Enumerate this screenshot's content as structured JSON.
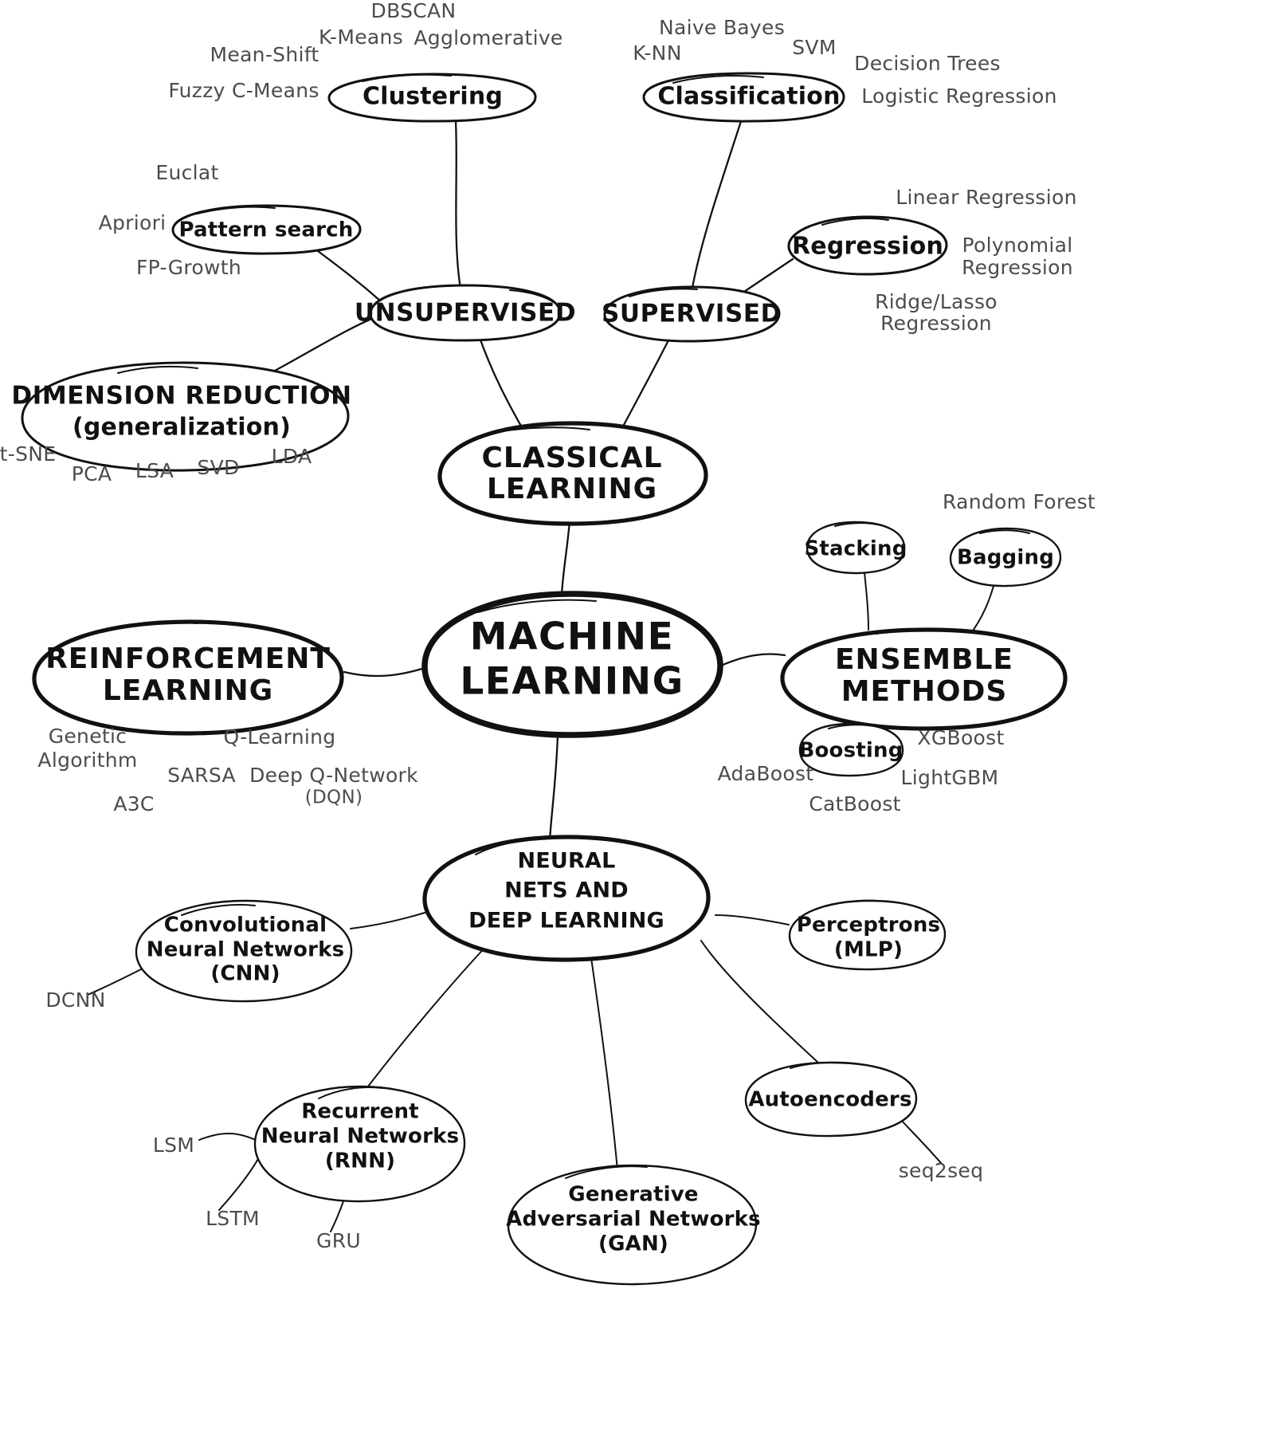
{
  "diagram": {
    "title": "Machine Learning",
    "type": "mind-map",
    "style": "hand-drawn",
    "background_color": "#ffffff",
    "node_stroke_color": "#111111",
    "leaf_text_color": "#4c4c4c"
  },
  "root": {
    "label_line1": "MACHINE",
    "label_line2": "LEARNING"
  },
  "branches": {
    "classical": {
      "label_line1": "CLASSICAL",
      "label_line2": "LEARNING",
      "children": {
        "unsupervised": {
          "label": "UNSUPERVISED",
          "children": {
            "clustering": {
              "label": "Clustering",
              "leaves": [
                "DBSCAN",
                "K-Means",
                "Agglomerative",
                "Mean-Shift",
                "Fuzzy C-Means"
              ]
            },
            "pattern_search": {
              "label": "Pattern search",
              "leaves": [
                "Euclat",
                "Apriori",
                "FP-Growth"
              ]
            },
            "dimension_reduction": {
              "label_line1": "DIMENSION REDUCTION",
              "label_line2": "(generalization)",
              "leaves": [
                "t-SNE",
                "PCA",
                "LSA",
                "SVD",
                "LDA"
              ]
            }
          }
        },
        "supervised": {
          "label": "SUPERVISED",
          "children": {
            "classification": {
              "label": "Classification",
              "leaves": [
                "Naive Bayes",
                "K-NN",
                "SVM",
                "Decision Trees",
                "Logistic Regression"
              ]
            },
            "regression": {
              "label": "Regression",
              "leaves": [
                "Linear Regression",
                "Polynomial",
                "Regression",
                "Ridge/Lasso",
                "Regression"
              ]
            }
          }
        }
      }
    },
    "reinforcement": {
      "label_line1": "REINFORCEMENT",
      "label_line2": "LEARNING",
      "leaves": [
        "Genetic",
        "Algorithm",
        "Q-Learning",
        "SARSA",
        "Deep Q-Network",
        "(DQN)",
        "A3C"
      ]
    },
    "ensemble": {
      "label_line1": "ENSEMBLE",
      "label_line2": "METHODS",
      "children": {
        "stacking": {
          "label": "Stacking"
        },
        "bagging": {
          "label": "Bagging",
          "leaves": [
            "Random Forest"
          ]
        },
        "boosting": {
          "label": "Boosting",
          "leaves": [
            "XGBoost",
            "LightGBM",
            "AdaBoost",
            "CatBoost"
          ]
        }
      }
    },
    "neural": {
      "label_line1": "NEURAL",
      "label_line2": "NETS AND",
      "label_line3": "DEEP LEARNING",
      "children": {
        "cnn": {
          "label_line1": "Convolutional",
          "label_line2": "Neural Networks",
          "label_line3": "(CNN)",
          "leaves": [
            "DCNN"
          ]
        },
        "rnn": {
          "label_line1": "Recurrent",
          "label_line2": "Neural Networks",
          "label_line3": "(RNN)",
          "leaves": [
            "LSM",
            "LSTM",
            "GRU"
          ]
        },
        "gan": {
          "label_line1": "Generative",
          "label_line2": "Adversarial Networks",
          "label_line3": "(GAN)"
        },
        "autoencoders": {
          "label": "Autoencoders",
          "leaves": [
            "seq2seq"
          ]
        },
        "perceptrons": {
          "label_line1": "Perceptrons",
          "label_line2": "(MLP)"
        }
      }
    }
  },
  "labels": {
    "dbscan": "DBSCAN",
    "kmeans": "K-Means",
    "agglomerative": "Agglomerative",
    "meanshift": "Mean-Shift",
    "fuzzycmeans": "Fuzzy C-Means",
    "clustering": "Clustering",
    "euclat": "Euclat",
    "apriori": "Apriori",
    "fpgrowth": "FP-Growth",
    "pattern_search": "Pattern search",
    "unsupervised": "UNSUPERVISED",
    "dimred_l1": "DIMENSION REDUCTION",
    "dimred_l2": "(generalization)",
    "tsne": "t-SNE",
    "pca": "PCA",
    "lsa": "LSA",
    "svd": "SVD",
    "lda": "LDA",
    "naive_bayes": "Naive Bayes",
    "knn": "K-NN",
    "svm": "SVM",
    "decision_trees": "Decision Trees",
    "logistic_regression": "Logistic Regression",
    "classification": "Classification",
    "supervised": "SUPERVISED",
    "regression": "Regression",
    "linear_regression": "Linear Regression",
    "polynomial": "Polynomial",
    "polynomial_regression": "Regression",
    "ridge_lasso": "Ridge/Lasso",
    "ridge_lasso_regression": "Regression",
    "classical_l1": "CLASSICAL",
    "classical_l2": "LEARNING",
    "root_l1": "MACHINE",
    "root_l2": "LEARNING",
    "reinforcement_l1": "REINFORCEMENT",
    "reinforcement_l2": "LEARNING",
    "genetic": "Genetic",
    "algorithm": "Algorithm",
    "qlearning": "Q-Learning",
    "sarsa": "SARSA",
    "dqn_l1": "Deep Q-Network",
    "dqn_l2": "(DQN)",
    "a3c": "A3C",
    "ensemble_l1": "ENSEMBLE",
    "ensemble_l2": "METHODS",
    "stacking": "Stacking",
    "bagging": "Bagging",
    "random_forest": "Random Forest",
    "boosting": "Boosting",
    "xgboost": "XGBoost",
    "lightgbm": "LightGBM",
    "adaboost": "AdaBoost",
    "catboost": "CatBoost",
    "neural_l1": "NEURAL",
    "neural_l2": "NETS AND",
    "neural_l3": "DEEP LEARNING",
    "cnn_l1": "Convolutional",
    "cnn_l2": "Neural Networks",
    "cnn_l3": "(CNN)",
    "dcnn": "DCNN",
    "rnn_l1": "Recurrent",
    "rnn_l2": "Neural Networks",
    "rnn_l3": "(RNN)",
    "lsm": "LSM",
    "lstm": "LSTM",
    "gru": "GRU",
    "gan_l1": "Generative",
    "gan_l2": "Adversarial Networks",
    "gan_l3": "(GAN)",
    "autoencoders": "Autoencoders",
    "seq2seq": "seq2seq",
    "perceptrons_l1": "Perceptrons",
    "perceptrons_l2": "(MLP)"
  }
}
